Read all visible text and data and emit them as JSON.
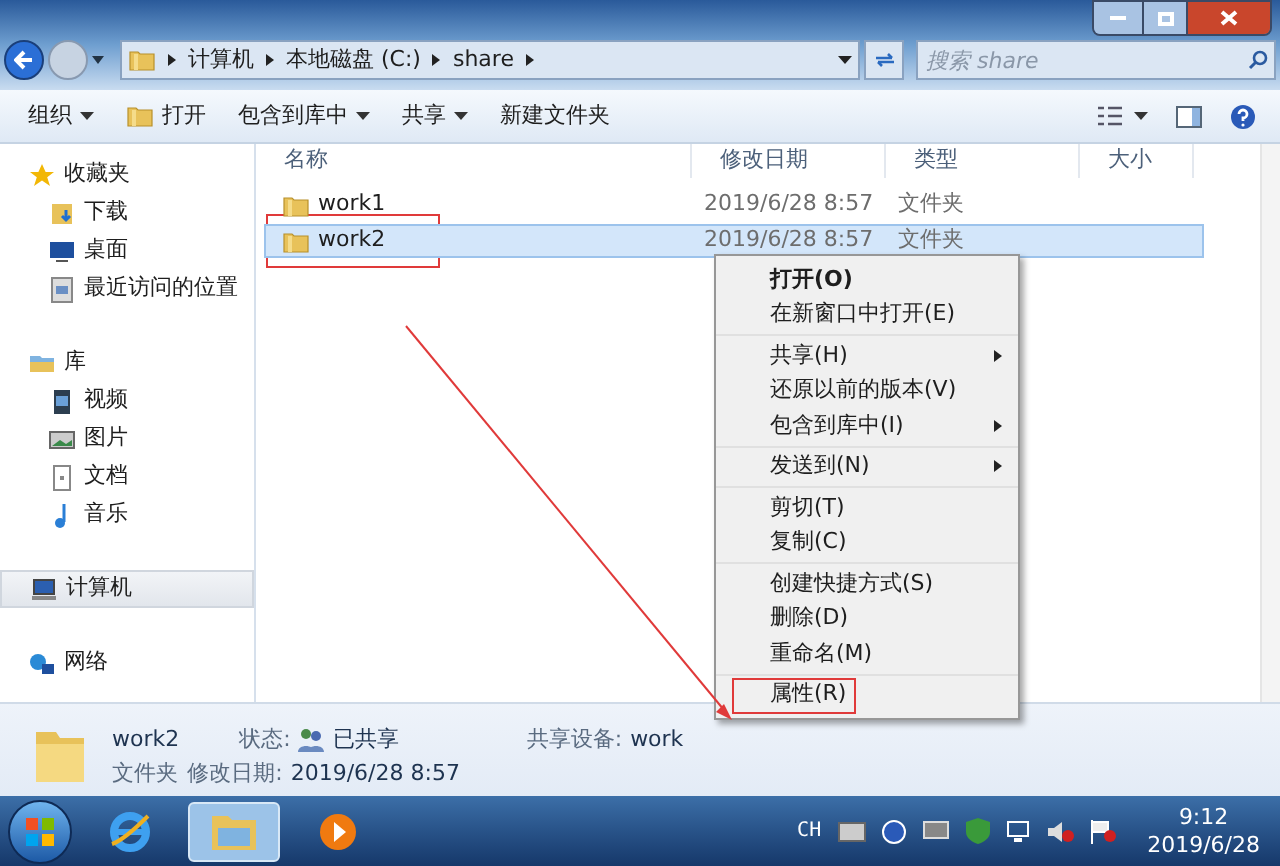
{
  "address_bar": {
    "crumbs": [
      "计算机",
      "本地磁盘 (C:)",
      "share"
    ]
  },
  "search": {
    "placeholder": "搜索 share"
  },
  "toolbar": [
    {
      "label": "组织",
      "dropdown": true,
      "icon": false
    },
    {
      "label": "打开",
      "dropdown": false,
      "icon": true
    },
    {
      "label": "包含到库中",
      "dropdown": true,
      "icon": false
    },
    {
      "label": "共享",
      "dropdown": true,
      "icon": false
    },
    {
      "label": "新建文件夹",
      "dropdown": false,
      "icon": false
    }
  ],
  "sidebar": [
    {
      "label": "收藏夹",
      "kind": "star",
      "selected": false,
      "children": [
        {
          "label": "下载",
          "kind": "download"
        },
        {
          "label": "桌面",
          "kind": "desktop"
        },
        {
          "label": "最近访问的位置",
          "kind": "recent"
        }
      ]
    },
    {
      "label": "库",
      "kind": "library",
      "selected": false,
      "children": [
        {
          "label": "视频",
          "kind": "video"
        },
        {
          "label": "图片",
          "kind": "image"
        },
        {
          "label": "文档",
          "kind": "doc"
        },
        {
          "label": "音乐",
          "kind": "music"
        }
      ]
    },
    {
      "label": "计算机",
      "kind": "computer",
      "selected": true
    },
    {
      "label": "网络",
      "kind": "network",
      "selected": false
    }
  ],
  "table": {
    "columns": [
      "名称",
      "修改日期",
      "类型",
      "大小"
    ],
    "rows": [
      {
        "name": "work1",
        "modified": "2019/6/28 8:57",
        "type": "文件夹",
        "selected": false,
        "annotated": false
      },
      {
        "name": "work2",
        "modified": "2019/6/28 8:57",
        "type": "文件夹",
        "selected": true,
        "annotated": true
      }
    ]
  },
  "context_menu": [
    [
      {
        "label": "打开(O)",
        "default": true,
        "submenu": false,
        "annotated": false
      },
      {
        "label": "在新窗口中打开(E)",
        "default": false,
        "submenu": false,
        "annotated": false
      }
    ],
    [
      {
        "label": "共享(H)",
        "default": false,
        "submenu": true,
        "annotated": false
      },
      {
        "label": "还原以前的版本(V)",
        "default": false,
        "submenu": false,
        "annotated": false
      },
      {
        "label": "包含到库中(I)",
        "default": false,
        "submenu": true,
        "annotated": false
      }
    ],
    [
      {
        "label": "发送到(N)",
        "default": false,
        "submenu": true,
        "annotated": false
      }
    ],
    [
      {
        "label": "剪切(T)",
        "default": false,
        "submenu": false,
        "annotated": false
      },
      {
        "label": "复制(C)",
        "default": false,
        "submenu": false,
        "annotated": false
      }
    ],
    [
      {
        "label": "创建快捷方式(S)",
        "default": false,
        "submenu": false,
        "annotated": false
      },
      {
        "label": "删除(D)",
        "default": false,
        "submenu": false,
        "annotated": false
      },
      {
        "label": "重命名(M)",
        "default": false,
        "submenu": false,
        "annotated": false
      }
    ],
    [
      {
        "label": "属性(R)",
        "default": false,
        "submenu": false,
        "annotated": true
      }
    ]
  ],
  "details": {
    "name": "work2",
    "type": "文件夹",
    "status_label": "状态:",
    "status": "已共享",
    "modified_label": "修改日期:",
    "modified": "2019/6/28 8:57",
    "share_label": "共享设备:",
    "share": "work"
  },
  "taskbar": {
    "language": "CH",
    "time": "9:12",
    "date": "2019/6/28"
  }
}
